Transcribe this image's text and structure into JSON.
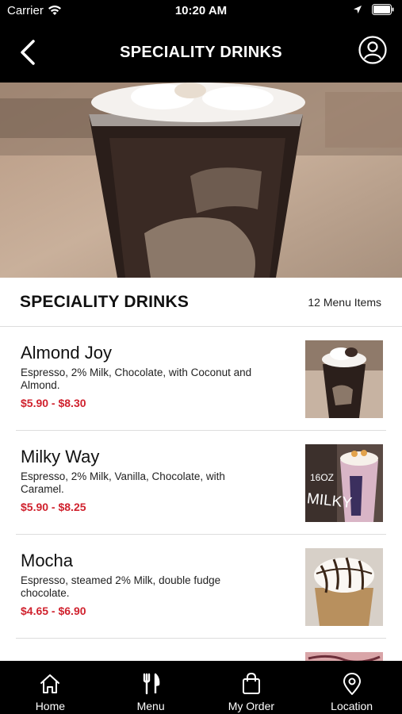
{
  "status_bar": {
    "carrier": "Carrier",
    "time": "10:20 AM"
  },
  "nav": {
    "title": "SPECIALITY DRINKS"
  },
  "section": {
    "title": "SPECIALITY DRINKS",
    "count": "12 Menu Items"
  },
  "items": [
    {
      "name": "Almond Joy",
      "description": "Espresso, 2% Milk, Chocolate, with Coconut and Almond.",
      "price": "$5.90 - $8.30"
    },
    {
      "name": "Milky Way",
      "description": "Espresso, 2% Milk, Vanilla, Chocolate, with Caramel.",
      "price": "$5.90 - $8.25",
      "cup_text_1": "16OZ",
      "cup_text_2": "MILKY"
    },
    {
      "name": "Mocha",
      "description": "Espresso, steamed 2%  Milk, double fudge chocolate.",
      "price": "$4.65 - $6.90"
    }
  ],
  "tabs": [
    {
      "label": "Home",
      "icon": "home-icon"
    },
    {
      "label": "Menu",
      "icon": "fork-knife-icon"
    },
    {
      "label": "My Order",
      "icon": "shopping-bag-icon"
    },
    {
      "label": "Location",
      "icon": "location-pin-icon"
    }
  ],
  "colors": {
    "price": "#d0222e",
    "bars": "#000000"
  }
}
